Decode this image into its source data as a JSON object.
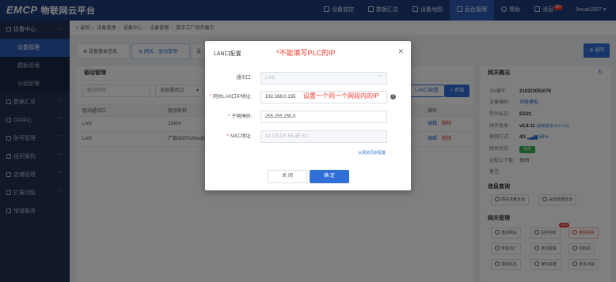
{
  "brand": {
    "logo": "EMCP",
    "name": "物联网云平台"
  },
  "topnav": [
    {
      "label": "设备监控"
    },
    {
      "label": "数据汇总"
    },
    {
      "label": "设备地图"
    },
    {
      "label": "后台管理"
    },
    {
      "label": "帮助"
    },
    {
      "label": "消息"
    }
  ],
  "msg_badge": "99+",
  "user_name": "Jincai1007",
  "sidebar": {
    "groups": [
      {
        "label": "设备中心"
      },
      {
        "label": "数据汇总"
      },
      {
        "label": "OA中心"
      },
      {
        "label": "账号管理"
      },
      {
        "label": "组织架构"
      },
      {
        "label": "店铺管理"
      },
      {
        "label": "扩展功能"
      },
      {
        "label": "增值服务"
      }
    ],
    "subitems": [
      {
        "label": "设备管理"
      },
      {
        "label": "模板管理"
      },
      {
        "label": "分组管理"
      }
    ]
  },
  "breadcrumb": {
    "back": "< 返回",
    "items": [
      "设备管理",
      "设备中心",
      "设备管理",
      "数字工厂综合展示"
    ]
  },
  "tabs": [
    {
      "label": "设备基本信息"
    },
    {
      "label": "网关、驱动管理"
    },
    {
      "label": "设"
    }
  ],
  "back_button": "返回",
  "driver_panel": {
    "title": "驱动管理",
    "search_placeholder": "驱动名称",
    "port_select": "全部通讯口",
    "lan_config_button": "LAN口配置",
    "add_button": "新增",
    "columns": {
      "port": "驱动通讯口",
      "name": "驱动名称",
      "ops": "操作"
    },
    "rows": [
      {
        "port": "LAN",
        "name": "12454",
        "edit": "编辑",
        "del": "删除"
      },
      {
        "port": "LAN",
        "name": "广数988TA(Modbus",
        "edit": "编辑",
        "del": "删除"
      }
    ]
  },
  "gateway_panel": {
    "title": "网关概况",
    "fields": [
      {
        "k": "SN编号:",
        "v": "210323051076"
      },
      {
        "k": "设备编码:",
        "v": "关联模板"
      },
      {
        "k": "型号标识:",
        "v": "EG21"
      },
      {
        "k": "固件版本:",
        "v": "v3.8.11",
        "note": "(有新版本v3.2.1.6)"
      },
      {
        "k": "联网方式:",
        "v": "4G",
        "signal": "68%"
      },
      {
        "k": "网关状态:",
        "v": "在线"
      },
      {
        "k": "远程上下载:",
        "v": "关闭"
      },
      {
        "k": "备注:",
        "v": ""
      }
    ],
    "info_title": "信息查询",
    "info_buttons": [
      "网关流量查询",
      "采样数据查询"
    ],
    "mgmt_title": "网关管理",
    "mgmt_buttons": [
      "重启网关",
      "固件更新",
      "删除网关",
      "恢复出厂",
      "离线报警",
      "回收机",
      "基础信息",
      "梯形数据",
      "更多功能"
    ],
    "new_badge": "NEW"
  },
  "modal": {
    "title": "LAN口配置",
    "annotation_top": "*不能填写PLC的IP",
    "annotation_ip": "设置一个同一个网段内的IP",
    "fields": [
      {
        "label": "通讯口:",
        "value": "LAN",
        "required": false,
        "disabled": true
      },
      {
        "label": "网关LAN口IP地址:",
        "value": "192.168.0.155",
        "required": true,
        "disabled": false
      },
      {
        "label": "子网掩码:",
        "value": "255.255.255.0",
        "required": true,
        "disabled": false
      },
      {
        "label": "MAC地址:",
        "value": "14-C5-CF-58-4E-51",
        "required": true,
        "disabled": true
      }
    ],
    "sync_link": "从网关同步配置",
    "cancel": "关 闭",
    "ok": "确 定"
  }
}
